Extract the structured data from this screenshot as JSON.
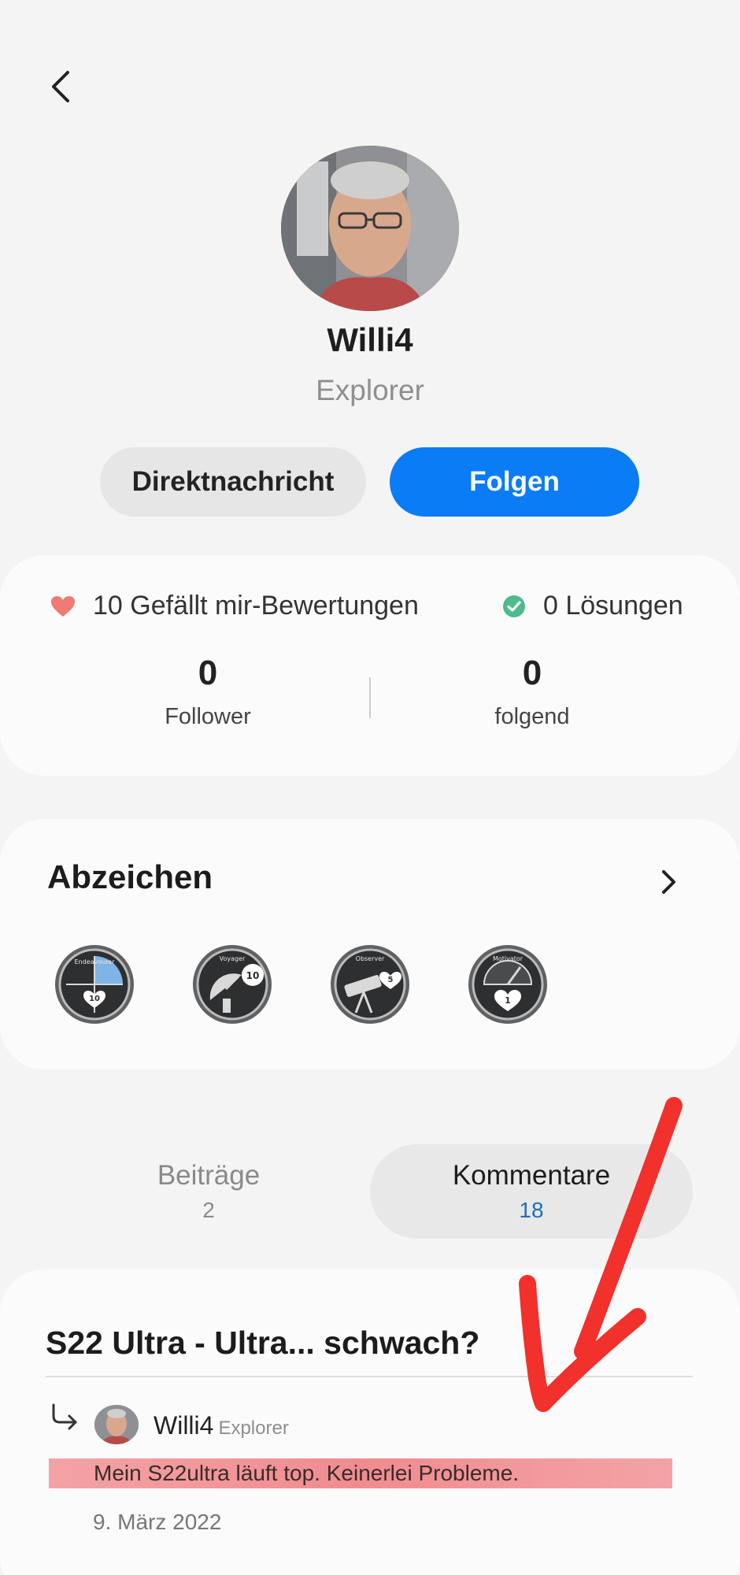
{
  "profile": {
    "username": "Willi4",
    "rank": "Explorer"
  },
  "actions": {
    "message_label": "Direktnachricht",
    "follow_label": "Folgen"
  },
  "stats": {
    "likes_text": "10 Gefällt mir-Bewertungen",
    "solutions_text": "0 Lösungen",
    "followers_count": "0",
    "followers_label": "Follower",
    "following_count": "0",
    "following_label": "folgend"
  },
  "badges": {
    "title": "Abzeichen",
    "items": [
      {
        "name": "Endeavourer",
        "level": "10"
      },
      {
        "name": "Voyager",
        "level": "10"
      },
      {
        "name": "Observer",
        "level": "5"
      },
      {
        "name": "Motivator",
        "level": "1"
      }
    ]
  },
  "tabs": [
    {
      "label": "Beiträge",
      "count": "2"
    },
    {
      "label": "Kommentare",
      "count": "18"
    }
  ],
  "comment": {
    "post_title": "S22 Ultra - Ultra... schwach?",
    "author": "Willi4",
    "author_rank": "Explorer",
    "text": "Mein S22ultra läuft top. Keinerlei Probleme.",
    "date": "9. März 2022"
  },
  "colors": {
    "accent": "#0a7cf6",
    "heart": "#ef7b72",
    "check": "#4dbb8c",
    "highlight": "#f08c90",
    "annotation": "#f2302c"
  },
  "icons": {
    "back": "chevron-left-icon",
    "likes": "heart-icon",
    "solutions": "check-circle-icon",
    "badges_more": "chevron-right-icon",
    "reply": "reply-arrow-icon"
  }
}
